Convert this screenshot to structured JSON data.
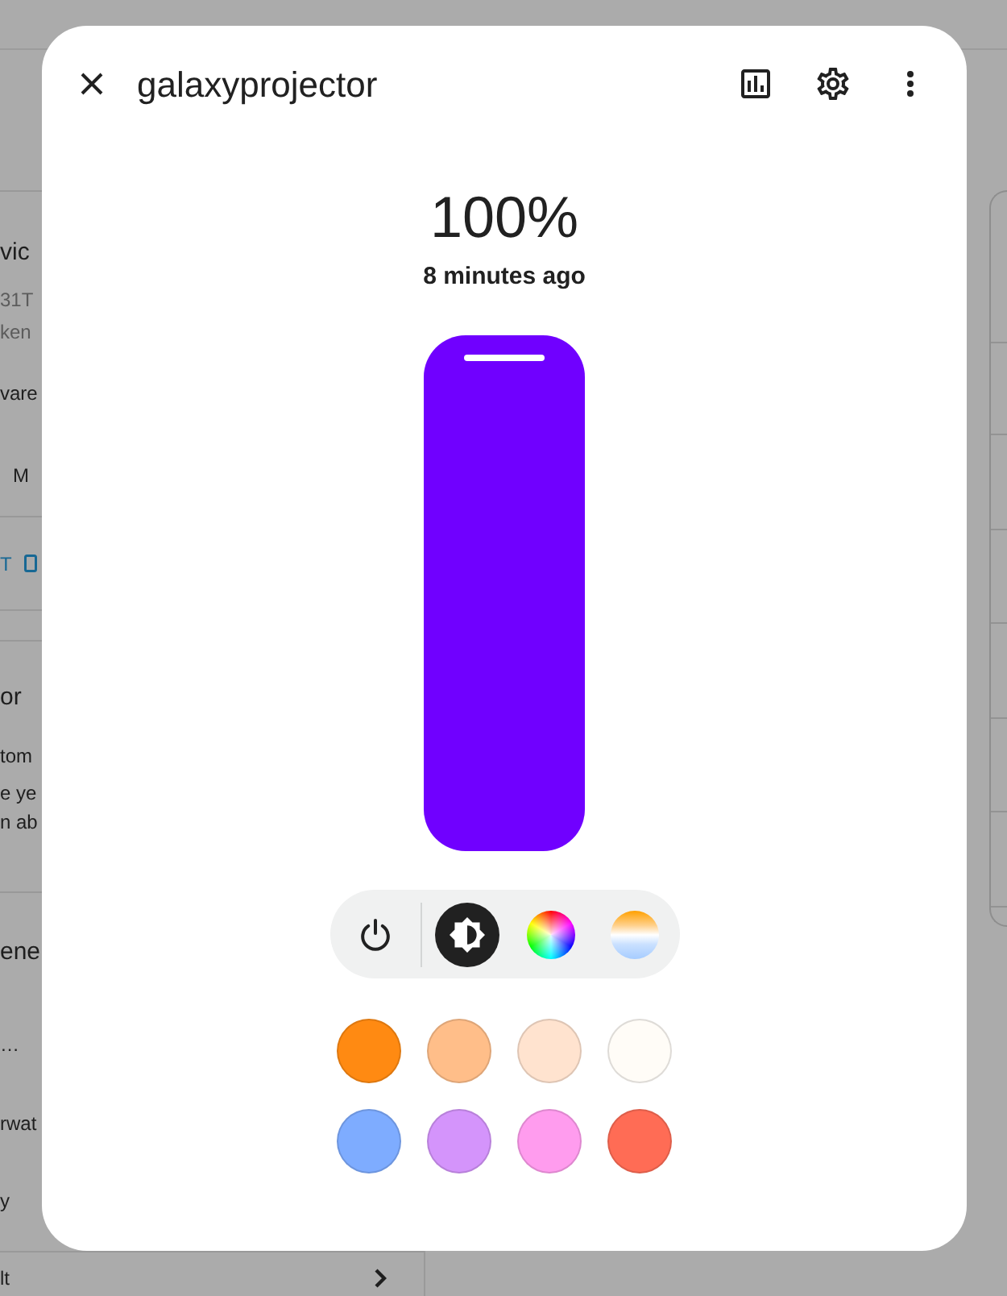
{
  "background": {
    "left_panel": [
      {
        "lines": [
          {
            "kind": "heading",
            "text": "vic"
          },
          {
            "kind": "caption",
            "text": "31T"
          },
          {
            "kind": "caption",
            "text": "ken"
          },
          {
            "kind": "body",
            "text": "vare"
          },
          {
            "kind": "item",
            "text": "M"
          }
        ]
      },
      {
        "lines": [
          {
            "kind": "link",
            "text": "T"
          }
        ]
      },
      {
        "lines": [
          {
            "kind": "heading",
            "text": "or"
          },
          {
            "kind": "body",
            "text": "tom"
          },
          {
            "kind": "body",
            "text": "e ye"
          },
          {
            "kind": "body",
            "text": "n ab"
          }
        ]
      },
      {
        "lines": [
          {
            "kind": "heading",
            "text": "ene"
          },
          {
            "kind": "body",
            "text": "…"
          },
          {
            "kind": "body",
            "text": "rwat"
          },
          {
            "kind": "body",
            "text": "y"
          }
        ]
      },
      {
        "lines": [
          {
            "kind": "nav",
            "text": "lt"
          }
        ]
      }
    ]
  },
  "dialog": {
    "title": "galaxyprojector",
    "brightness": {
      "value": "100%",
      "updated": "8 minutes ago",
      "level": 1
    },
    "modes": [
      {
        "kind": "brightness",
        "selected": true
      },
      {
        "kind": "color",
        "selected": false
      },
      {
        "kind": "temperature",
        "selected": false
      }
    ],
    "presets": [
      {
        "color": "#ff8a12"
      },
      {
        "color": "#ffbe89"
      },
      {
        "color": "#ffe3cf"
      },
      {
        "color": "#fffcf7"
      },
      {
        "color": "#7eacff"
      },
      {
        "color": "#d494fb"
      },
      {
        "color": "#ff9cee"
      },
      {
        "color": "#ff6c55"
      }
    ]
  }
}
